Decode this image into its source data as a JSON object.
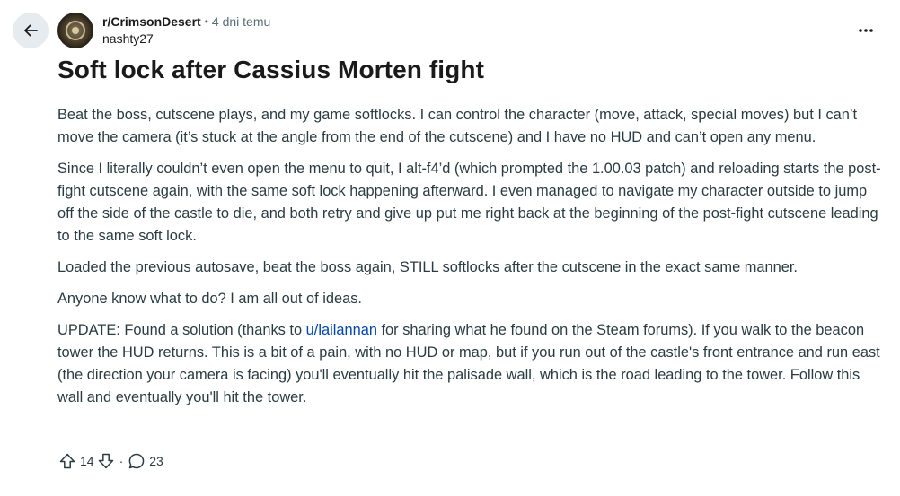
{
  "header": {
    "subreddit": "r/CrimsonDesert",
    "separator": "•",
    "time": "4 dni temu",
    "username": "nashty27"
  },
  "icons": {
    "back": "arrow-left-icon",
    "avatar": "subreddit-avatar",
    "overflow": "more-horizontal-icon",
    "upvote": "upvote-arrow-icon",
    "downvote": "downvote-arrow-icon",
    "comment": "comment-bubble-icon"
  },
  "post": {
    "title": "Soft lock after Cassius Morten fight",
    "paragraphs": [
      "Beat the boss, cutscene plays, and my game softlocks. I can control the character (move, attack, special moves) but I can’t move the camera (it’s stuck at the angle from the end of the cutscene) and I have no HUD and can’t open any menu.",
      "Since I literally couldn’t even open the menu to quit, I alt-f4’d (which prompted the 1.00.03 patch) and reloading starts the post-fight cutscene again, with the same soft lock happening afterward. I even managed to navigate my character outside to jump off the side of the castle to die, and both retry and give up put me right back at the beginning of the post-fight cutscene leading to the same soft lock.",
      "Loaded the previous autosave, beat the boss again, STILL softlocks after the cutscene in the exact same manner.",
      "Anyone know what to do? I am all out of ideas."
    ],
    "update": {
      "before_link": "UPDATE: Found a solution (thanks to ",
      "link_text": "u/lailannan",
      "after_link": " for sharing what he found on the Steam forums). If you walk to the beacon tower the HUD returns. This is a bit of a pain, with no HUD or map, but if you run out of the castle's front entrance and run east (the direction your camera is facing) you'll eventually hit the palisade wall, which is the road leading to the tower. Follow this wall and eventually you'll hit the tower."
    }
  },
  "actions": {
    "upvotes": "14",
    "separator": "·",
    "comments": "23"
  },
  "colors": {
    "text": "#1a1a1b",
    "body_text": "#2a3c42",
    "muted": "#576f76",
    "link": "#0045ac",
    "back_button_bg": "#e5ebee"
  }
}
